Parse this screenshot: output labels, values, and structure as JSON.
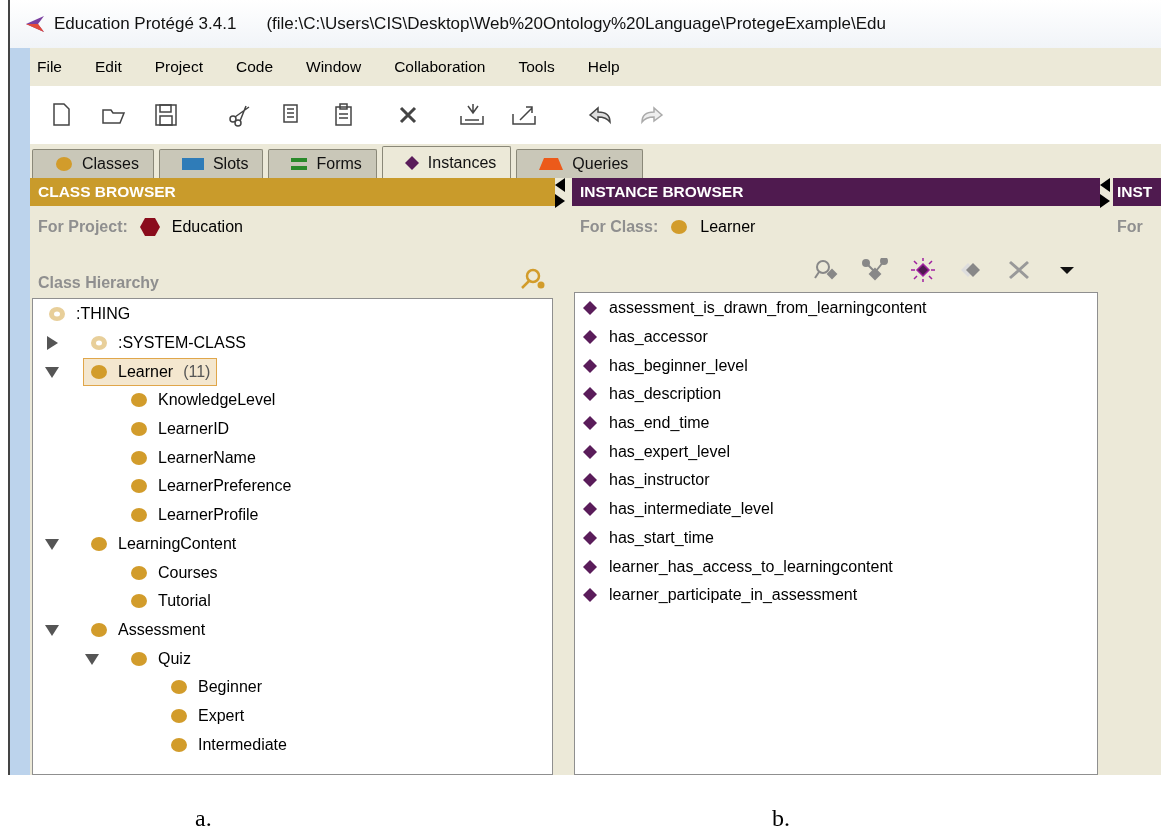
{
  "window": {
    "app": "Education  Protégé 3.4.1",
    "path": "(file:\\C:\\Users\\CIS\\Desktop\\Web%20Ontology%20Language\\ProtegeExample\\Edu"
  },
  "menu": [
    "File",
    "Edit",
    "Project",
    "Code",
    "Window",
    "Collaboration",
    "Tools",
    "Help"
  ],
  "toolbar": [
    {
      "kind": "new"
    },
    {
      "kind": "open"
    },
    {
      "kind": "save"
    },
    {
      "kind": "cut"
    },
    {
      "kind": "copy"
    },
    {
      "kind": "paste"
    },
    {
      "kind": "delete"
    },
    {
      "kind": "import"
    },
    {
      "kind": "export"
    },
    {
      "kind": "undo"
    },
    {
      "kind": "redo"
    }
  ],
  "tabs": [
    {
      "label": "Classes",
      "kind": "classes",
      "selected": false
    },
    {
      "label": "Slots",
      "kind": "slots",
      "selected": false
    },
    {
      "label": "Forms",
      "kind": "forms",
      "selected": false
    },
    {
      "label": "Instances",
      "kind": "instances",
      "selected": true
    },
    {
      "label": "Queries",
      "kind": "queries",
      "selected": false
    }
  ],
  "class_browser": {
    "title": "CLASS BROWSER",
    "for_label": "For Project:",
    "project": "Education",
    "hierarchy_label": "Class Hierarchy",
    "tree": {
      "label": ":THING",
      "system": true,
      "selected": false,
      "children": [
        {
          "label": ":SYSTEM-CLASS",
          "system": true,
          "expanded": false,
          "selected": false
        },
        {
          "label": "Learner",
          "count": "(11)",
          "system": false,
          "expanded": true,
          "selected": true,
          "children": [
            {
              "label": "KnowledgeLevel",
              "system": false,
              "selected": false
            },
            {
              "label": "LearnerID",
              "system": false,
              "selected": false
            },
            {
              "label": "LearnerName",
              "system": false,
              "selected": false
            },
            {
              "label": "LearnerPreference",
              "system": false,
              "selected": false
            },
            {
              "label": "LearnerProfile",
              "system": false,
              "selected": false
            }
          ]
        },
        {
          "label": "LearningContent",
          "system": false,
          "expanded": true,
          "selected": false,
          "children": [
            {
              "label": "Courses",
              "system": false,
              "selected": false
            },
            {
              "label": "Tutorial",
              "system": false,
              "selected": false
            }
          ]
        },
        {
          "label": "Assessment",
          "system": false,
          "expanded": true,
          "selected": false,
          "children": [
            {
              "label": "Quiz",
              "system": false,
              "expanded": true,
              "selected": false,
              "children": [
                {
                  "label": "Beginner",
                  "system": false,
                  "selected": false
                },
                {
                  "label": "Expert",
                  "system": false,
                  "selected": false
                },
                {
                  "label": "Intermediate",
                  "system": false,
                  "selected": false
                }
              ]
            }
          ]
        }
      ]
    }
  },
  "instance_browser": {
    "title": "INSTANCE BROWSER",
    "for_label": "For Class:",
    "class": "Learner",
    "tools": [
      {
        "kind": "find"
      },
      {
        "kind": "references"
      },
      {
        "kind": "create"
      },
      {
        "kind": "copy"
      },
      {
        "kind": "delete"
      },
      {
        "kind": "menu"
      }
    ],
    "instances": [
      "assessment_is_drawn_from_learningcontent",
      "has_accessor",
      "has_beginner_level",
      "has_description",
      "has_end_time",
      "has_expert_level",
      "has_instructor",
      "has_intermediate_level",
      "has_start_time",
      "learner_has_access_to_learningcontent",
      "learner_participate_in_assessment"
    ]
  },
  "third_panel": {
    "title": "INST",
    "for_label": "For"
  },
  "captions": [
    "a.",
    "b."
  ]
}
